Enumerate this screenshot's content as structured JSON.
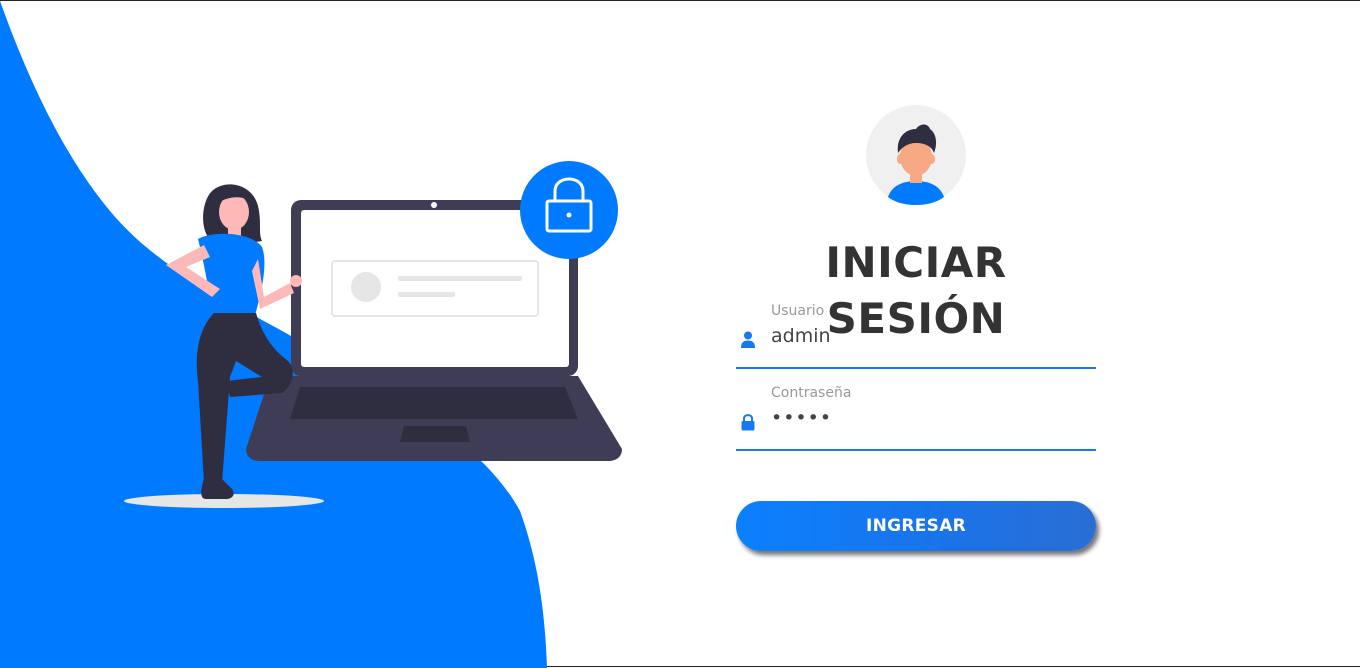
{
  "colors": {
    "accent": "#007bff",
    "dark_text": "#333333",
    "label_text": "#999999",
    "underline": "#1778f2"
  },
  "login": {
    "title": "INICIAR SESIÓN",
    "username": {
      "label": "Usuario",
      "value": "admin",
      "icon": "user-icon"
    },
    "password": {
      "label": "Contraseña",
      "value": "•••••",
      "icon": "lock-icon"
    },
    "submit_label": "INGRESAR"
  },
  "illustration": {
    "icons": [
      "woman-figure",
      "laptop-icon",
      "padlock-icon",
      "avatar-icon"
    ]
  }
}
